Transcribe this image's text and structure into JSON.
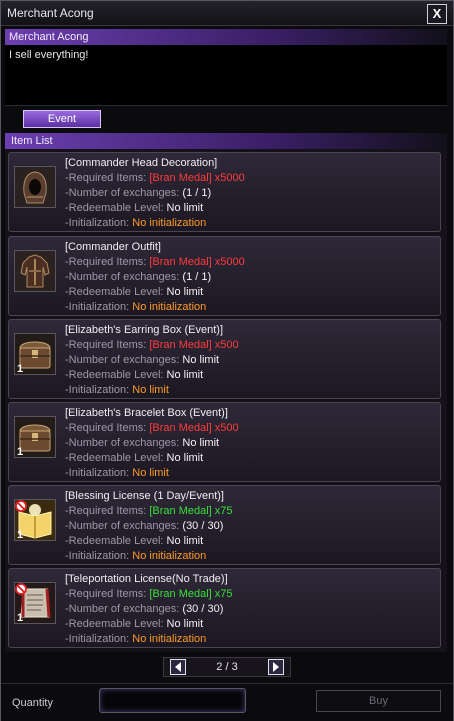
{
  "window": {
    "title": "Merchant Acong",
    "close_label": "X",
    "npc_name": "Merchant Acong",
    "greeting": "I sell everything!"
  },
  "tabs": [
    {
      "label": "Event",
      "active": true
    }
  ],
  "list_header": "Item List",
  "labels": {
    "required": "-Required Items:",
    "exchanges": "-Number of exchanges:",
    "level": "-Redeemable Level:",
    "init": "-Initialization:"
  },
  "items": [
    {
      "name": "[Commander Head Decoration]",
      "required": "[Bran Medal] x5000",
      "required_color": "#ff3b3b",
      "exchanges": "(1 / 1)",
      "level": "No limit",
      "init": "No initialization",
      "qty": "",
      "icon": "hood-icon"
    },
    {
      "name": "[Commander Outfit]",
      "required": "[Bran Medal] x5000",
      "required_color": "#ff3b3b",
      "exchanges": "(1 / 1)",
      "level": "No limit",
      "init": "No initialization",
      "qty": "",
      "icon": "armor-icon"
    },
    {
      "name": "[Elizabeth's Earring Box (Event)]",
      "required": "[Bran Medal] x500",
      "required_color": "#ff3b3b",
      "exchanges": "No limit",
      "level": "No limit",
      "init": "No limit",
      "qty": "1",
      "icon": "chest-icon"
    },
    {
      "name": "[Elizabeth's Bracelet Box (Event)]",
      "required": "[Bran Medal] x500",
      "required_color": "#ff3b3b",
      "exchanges": "No limit",
      "level": "No limit",
      "init": "No limit",
      "qty": "1",
      "icon": "chest-icon"
    },
    {
      "name": "[Blessing License (1 Day/Event)]",
      "required": "[Bran Medal] x75",
      "required_color": "#38e038",
      "exchanges": "(30 / 30)",
      "level": "No limit",
      "init": "No initialization",
      "qty": "1",
      "icon": "license-book-icon"
    },
    {
      "name": "[Teleportation License(No Trade)]",
      "required": "[Bran Medal] x75",
      "required_color": "#38e038",
      "exchanges": "(30 / 30)",
      "level": "No limit",
      "init": "No initialization",
      "qty": "1",
      "icon": "scroll-icon"
    }
  ],
  "pagination": {
    "text": "2 / 3",
    "prev_icon": "prev-arrow-icon",
    "next_icon": "next-arrow-icon"
  },
  "footer": {
    "quantity_label": "Quantity",
    "quantity_value": "",
    "buy_label": "Buy"
  }
}
